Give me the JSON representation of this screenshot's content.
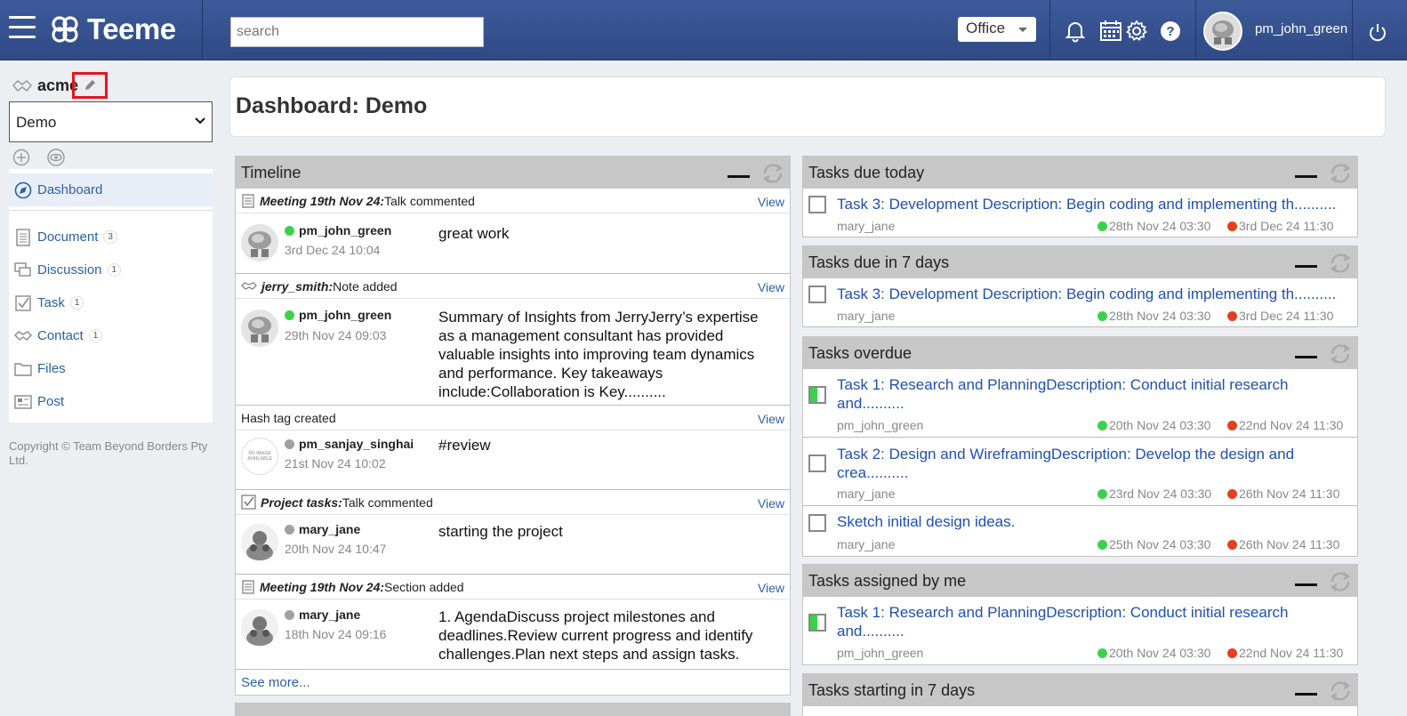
{
  "app": {
    "name": "Teeme"
  },
  "header": {
    "search_placeholder": "search",
    "workspace": "Office",
    "username": "pm_john_green"
  },
  "sidebar": {
    "org": "acme",
    "dashboard_select": "Demo",
    "items": [
      {
        "label": "Dashboard",
        "count": ""
      },
      {
        "label": "Document",
        "count": "3"
      },
      {
        "label": "Discussion",
        "count": "1"
      },
      {
        "label": "Task",
        "count": "1"
      },
      {
        "label": "Contact",
        "count": "1"
      },
      {
        "label": "Files",
        "count": ""
      },
      {
        "label": "Post",
        "count": ""
      }
    ],
    "copyright": "Copyright © Team Beyond Borders Pty Ltd."
  },
  "main": {
    "title": "Dashboard: Demo"
  },
  "timeline": {
    "title": "Timeline",
    "view_label": "View",
    "items": [
      {
        "context": "Meeting 19th Nov 24:",
        "action": " Talk commented",
        "user": "pm_john_green",
        "date": "3rd Dec 24 10:04",
        "text": "great work"
      },
      {
        "context": "jerry_smith:",
        "action": " Note added",
        "user": "pm_john_green",
        "date": "29th Nov 24 09:03",
        "text": "Summary of Insights from JerryJerry’s expertise as a management consultant has provided valuable insights into improving team dynamics and performance. Key takeaways include:Collaboration is Key.........."
      },
      {
        "context": "",
        "action": "Hash tag created",
        "user": "pm_sanjay_singhai",
        "date": "21st Nov 24 10:02",
        "text": "#review",
        "avatar_text": "NO IMAGE AVAILABLE"
      },
      {
        "context": "Project tasks:",
        "action": " Talk commented",
        "user": "mary_jane",
        "date": "20th Nov 24 10:47",
        "text": "starting the project"
      },
      {
        "context": "Meeting 19th Nov 24:",
        "action": " Section added",
        "user": "mary_jane",
        "date": "18th Nov 24 09:16",
        "text": "1. AgendaDiscuss project milestones and deadlines.Review current progress and identify challenges.Plan next steps and assign tasks."
      }
    ],
    "see_more": "See more..."
  },
  "task_widgets": {
    "due_today": {
      "title": "Tasks due today",
      "tasks": [
        {
          "title": "Task 3: Development Description: Begin coding and implementing th..........",
          "user": "mary_jane",
          "start": "28th Nov 24 03:30",
          "end": "3rd Dec 24 11:30",
          "progress": 0
        }
      ]
    },
    "due_7": {
      "title": "Tasks due in 7 days",
      "tasks": [
        {
          "title": "Task 3: Development Description: Begin coding and implementing th..........",
          "user": "mary_jane",
          "start": "28th Nov 24 03:30",
          "end": "3rd Dec 24 11:30",
          "progress": 0
        }
      ]
    },
    "overdue": {
      "title": "Tasks overdue",
      "tasks": [
        {
          "title": "Task 1: Research and PlanningDescription: Conduct initial research and..........",
          "user": "pm_john_green",
          "start": "20th Nov 24 03:30",
          "end": "22nd Nov 24 11:30",
          "progress": 0.5
        },
        {
          "title": "Task 2: Design and WireframingDescription: Develop the design and crea..........",
          "user": "mary_jane",
          "start": "23rd Nov 24 03:30",
          "end": "26th Nov 24 11:30",
          "progress": 0
        },
        {
          "title": "Sketch initial design ideas.",
          "user": "mary_jane",
          "start": "25th Nov 24 03:30",
          "end": "26th Nov 24 11:30",
          "progress": 0
        }
      ]
    },
    "assigned": {
      "title": "Tasks assigned by me",
      "tasks": [
        {
          "title": "Task 1: Research and PlanningDescription: Conduct initial research and..........",
          "user": "pm_john_green",
          "start": "20th Nov 24 03:30",
          "end": "22nd Nov 24 11:30",
          "progress": 0.5
        }
      ]
    },
    "starting_7": {
      "title": "Tasks starting in 7 days"
    }
  },
  "colors": {
    "header": "#2f4a85",
    "link": "#1f4fb0",
    "start_dot": "#3ad24a",
    "end_dot": "#e3401e"
  }
}
